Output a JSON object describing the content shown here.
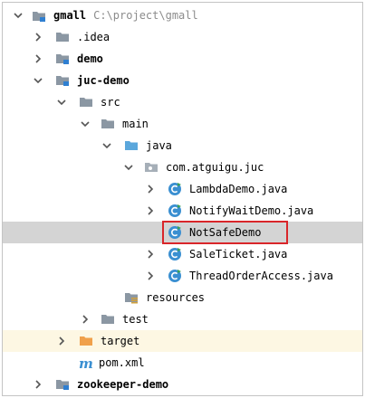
{
  "tree": {
    "rows": [
      {
        "label": "gmall",
        "path": "C:\\project\\gmall",
        "icon": "module-folder-icon",
        "expanded": true
      },
      {
        "label": ".idea",
        "icon": "folder-icon",
        "expanded": false
      },
      {
        "label": "demo",
        "icon": "module-folder-icon",
        "expanded": false
      },
      {
        "label": "juc-demo",
        "icon": "module-folder-icon",
        "expanded": true
      },
      {
        "label": "src",
        "icon": "folder-icon",
        "expanded": true
      },
      {
        "label": "main",
        "icon": "folder-icon",
        "expanded": true
      },
      {
        "label": "java",
        "icon": "source-folder-icon",
        "expanded": true
      },
      {
        "label": "com.atguigu.juc",
        "icon": "package-icon",
        "expanded": true
      },
      {
        "label": "LambdaDemo.java",
        "icon": "java-class-icon",
        "expanded": false
      },
      {
        "label": "NotifyWaitDemo.java",
        "icon": "java-class-icon",
        "expanded": false
      },
      {
        "label": "NotSafeDemo",
        "icon": "java-class-icon",
        "selected": true
      },
      {
        "label": "SaleTicket.java",
        "icon": "java-class-icon",
        "expanded": false
      },
      {
        "label": "ThreadOrderAccess.java",
        "icon": "java-class-icon",
        "expanded": false
      },
      {
        "label": "resources",
        "icon": "resources-folder-icon"
      },
      {
        "label": "test",
        "icon": "folder-icon",
        "expanded": false
      },
      {
        "label": "target",
        "icon": "excluded-folder-icon",
        "expanded": false
      },
      {
        "label": "pom.xml",
        "icon": "maven-icon"
      },
      {
        "label": "zookeeper-demo",
        "icon": "module-folder-icon",
        "expanded": false
      }
    ]
  },
  "colors": {
    "folder": "#8b97a3",
    "source_folder": "#5ba7dc",
    "excluded_folder": "#f0a04b",
    "java_class": "#3a8fd1",
    "module_marker": "#2f7fd1",
    "selection": "#d4d4d4",
    "highlight_box": "#d9262a"
  }
}
